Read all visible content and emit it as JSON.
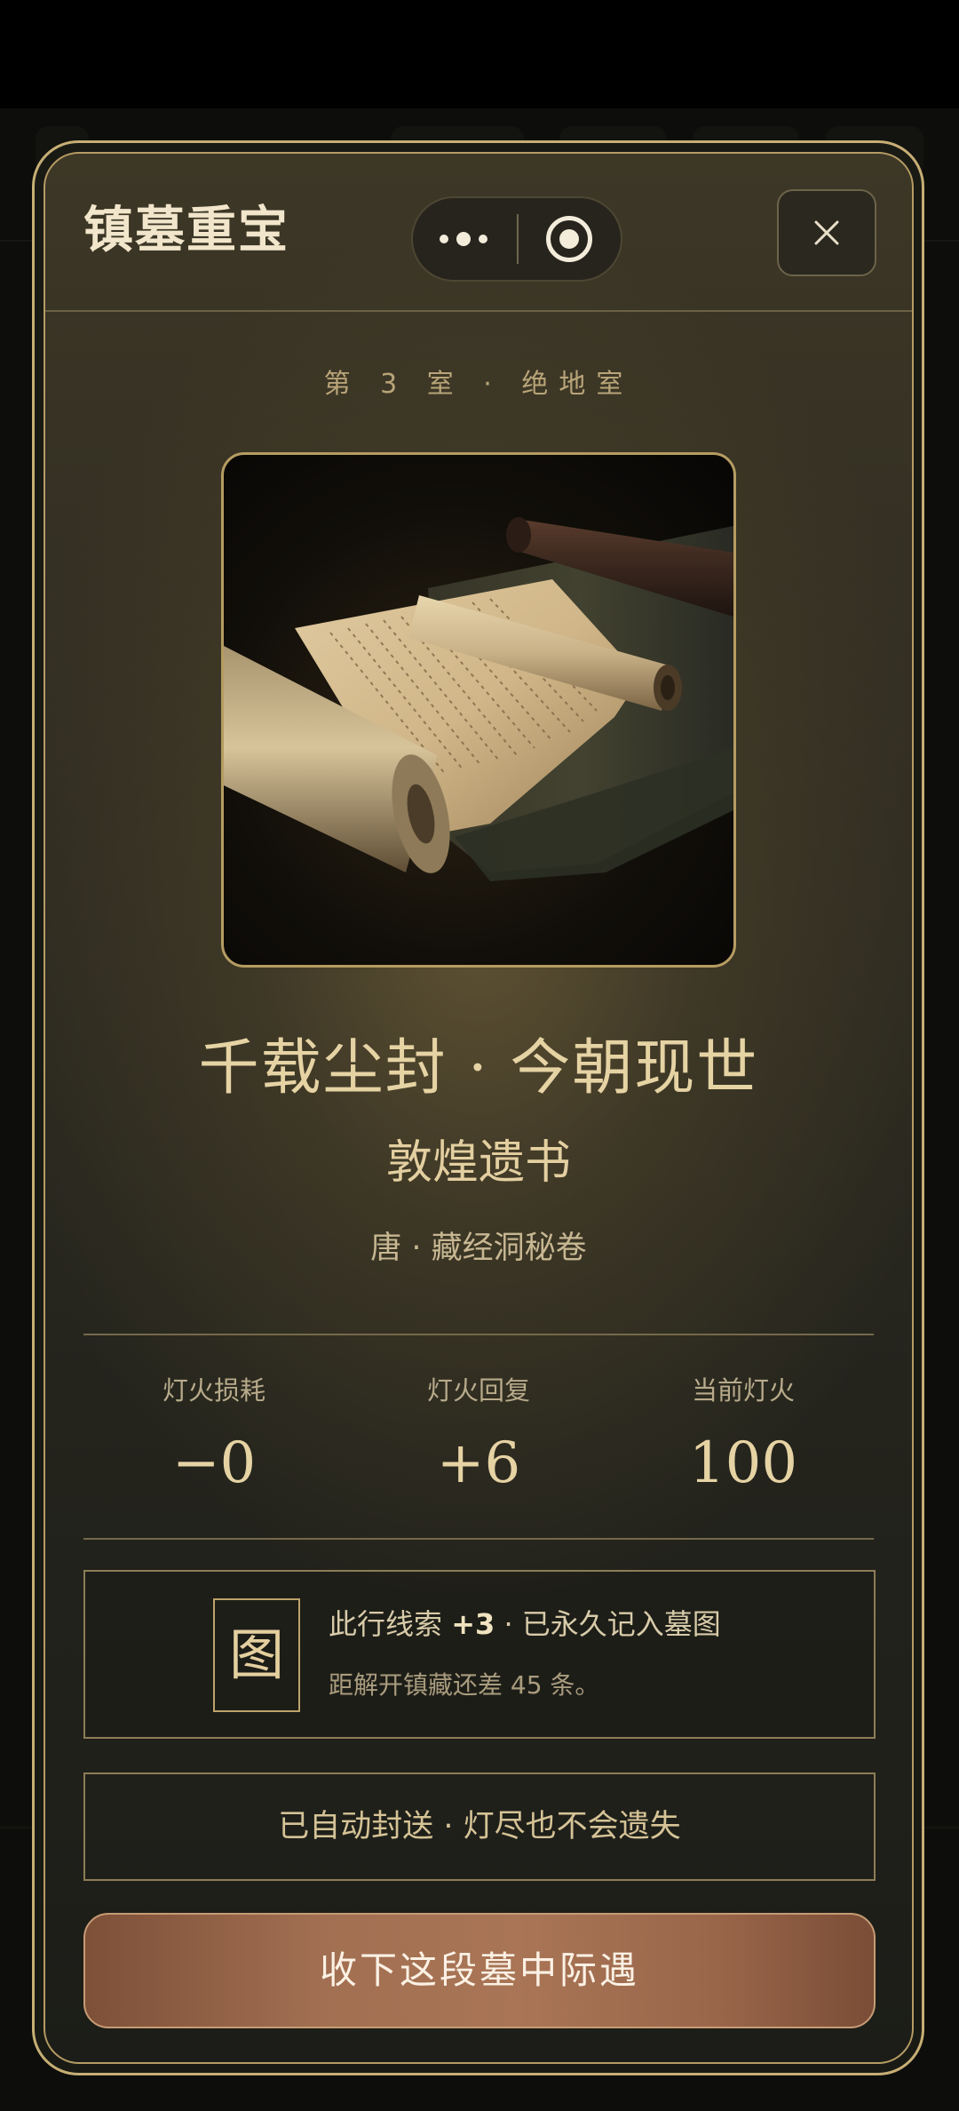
{
  "app": {
    "title": "镇墓重宝"
  },
  "capsule": {
    "more_icon": "more-dots-icon",
    "target_icon": "record-target-icon"
  },
  "close_icon": "close-icon",
  "room": {
    "label": "第 3 室 · 绝地室"
  },
  "artifact": {
    "image_subject": "scroll-image",
    "headline": "千载尘封 · 今朝现世",
    "name": "敦煌遗书",
    "meta": "唐 · 藏经洞秘卷"
  },
  "stats": [
    {
      "label": "灯火损耗",
      "value": "−0"
    },
    {
      "label": "灯火回复",
      "value": "+6"
    },
    {
      "label": "当前灯火",
      "value": "100"
    }
  ],
  "clue": {
    "icon_glyph": "图",
    "prefix": "此行线索 ",
    "count": "+3",
    "suffix": " · 已永久记入墓图",
    "note": "距解开镇藏还差 45 条。"
  },
  "auto_notice": "已自动封送 · 灯尽也不会遗失",
  "accept_button": "收下这段墓中际遇",
  "colors": {
    "gold_border": "#c6ae74",
    "accent_text": "#e6d3a4",
    "button": "#a26f52"
  }
}
